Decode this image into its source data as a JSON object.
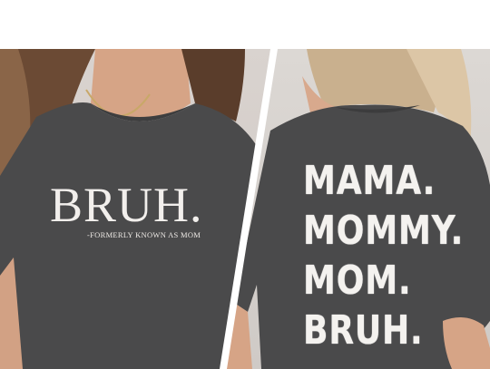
{
  "front": {
    "title": "BRUH.",
    "subtitle": "-FORMERLY KNOWN AS MOM"
  },
  "back": {
    "lines": [
      "MAMA.",
      "MOMMY.",
      "MOM.",
      "BRUH."
    ]
  },
  "colors": {
    "shirt": "#4a4a4b",
    "print": "#f2efec",
    "hair_front": "#6b4a34",
    "hair_back": "#c9b08e",
    "skin": "#d9a98c"
  }
}
